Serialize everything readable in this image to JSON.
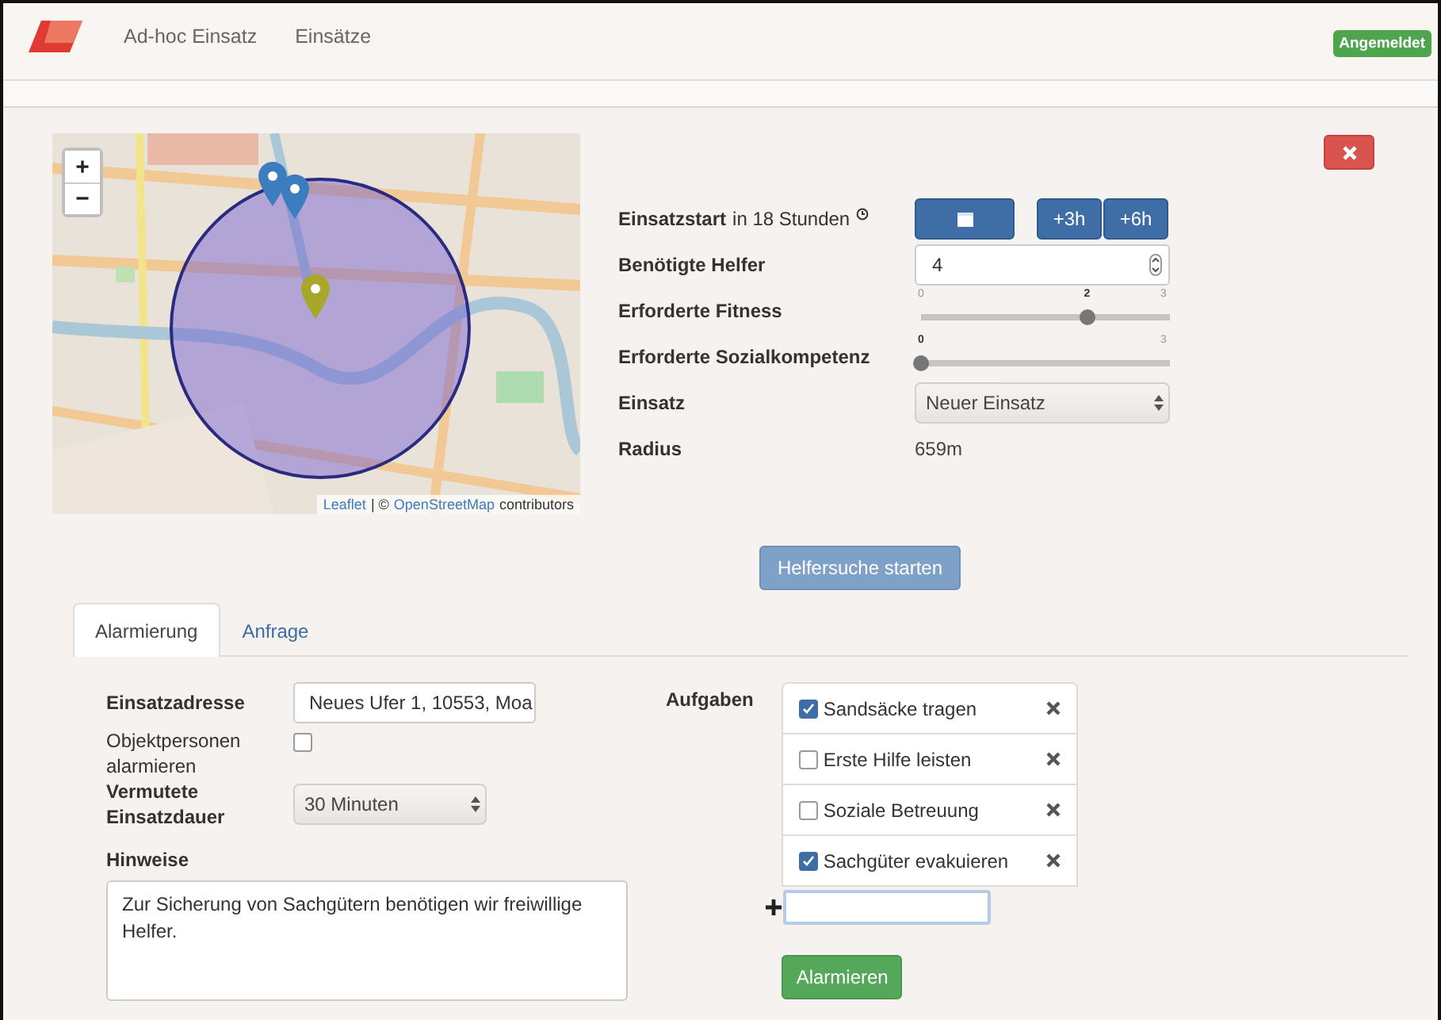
{
  "navbar": {
    "items": [
      {
        "label": "Ad-hoc Einsatz"
      },
      {
        "label": "Einsätze"
      }
    ],
    "status": "Angemeldet"
  },
  "map": {
    "zoom_in": "+",
    "zoom_out": "−",
    "attribution": {
      "link1": "Leaflet",
      "middle": "| ©",
      "link2": "OpenStreetMap",
      "rest": "contributors"
    }
  },
  "form": {
    "start": {
      "label_bold": "Einsatzstart",
      "label_rest": "in 18 Stunden",
      "quick_buttons": [
        "+3h",
        "+6h"
      ]
    },
    "helpers": {
      "label": "Benötigte Helfer",
      "value": "4"
    },
    "sliders": [
      {
        "label": "Erforderte Fitness",
        "min": "0",
        "value": "2",
        "max": "3",
        "level": 0.667
      },
      {
        "label": "Erforderte Sozialkompetenz",
        "value": "0",
        "max": "3",
        "level": 0
      }
    ],
    "einsatz": {
      "label": "Einsatz",
      "value": "Neuer Einsatz"
    },
    "radius": {
      "label": "Radius",
      "value": "659m"
    },
    "search_button": {
      "label": "Helfersuche starten",
      "disabled": true
    }
  },
  "tabs": [
    {
      "label": "Alarmierung",
      "selected": true
    },
    {
      "label": "Anfrage",
      "selected": false
    }
  ],
  "alarm": {
    "address": {
      "label": "Einsatzadresse",
      "value": "Neues Ufer 1, 10553, Moa"
    },
    "notify": {
      "label": "Objektpersonen alarmieren",
      "checked": false
    },
    "duration": {
      "label": "Vermutete Einsatzdauer",
      "value": "30 Minuten"
    },
    "notes": {
      "label": "Hinweise",
      "value": "Zur Sicherung von Sachgütern benötigen wir freiwillige Helfer."
    },
    "tasks": {
      "label": "Aufgaben",
      "items": [
        {
          "label": "Sandsäcke tragen",
          "checked": true
        },
        {
          "label": "Erste Hilfe leisten",
          "checked": false
        },
        {
          "label": "Soziale Betreuung",
          "checked": false
        },
        {
          "label": "Sachgüter evakuieren",
          "checked": true
        }
      ]
    },
    "submit": "Alarmieren"
  }
}
